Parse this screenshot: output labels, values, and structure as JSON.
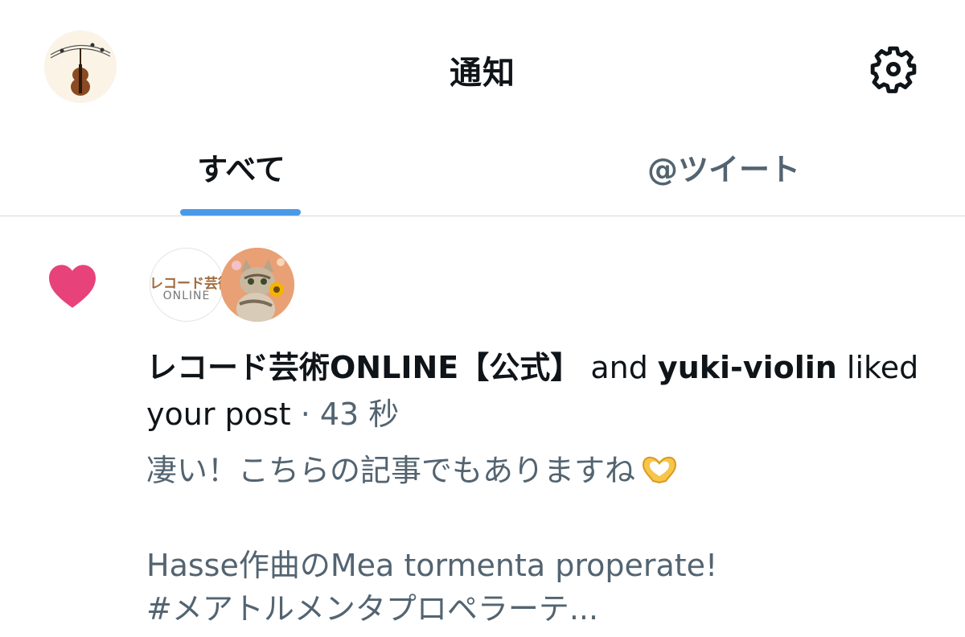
{
  "header": {
    "title": "通知",
    "avatar_icon": "violin-avatar",
    "settings_icon": "gear-icon"
  },
  "tabs": [
    {
      "label": "すべて",
      "active": true
    },
    {
      "label": "@ツイート",
      "active": false
    }
  ],
  "accent_color": "#4a99e9",
  "like_color": "#e8427a",
  "notification": {
    "type": "like",
    "icon": "heart-icon",
    "likers": [
      {
        "name": "レコード芸術ONLINE【公式】",
        "avatar_text_1": "レコード芸術",
        "avatar_text_2": "ONLINE"
      },
      {
        "name": "yuki-violin",
        "avatar_icon": "cat-avatar"
      }
    ],
    "joiner": "and",
    "action_line1": "liked",
    "action_line2": "your post",
    "separator": "·",
    "time": "43 秒",
    "preview_line1": "凄い！こちらの記事でもありますね",
    "preview_emoji": "heart-hands-emoji",
    "preview_line2": "Hasse作曲のMea tormenta properate!",
    "preview_line3": "#メアトルメンタプロペラーテ..."
  }
}
